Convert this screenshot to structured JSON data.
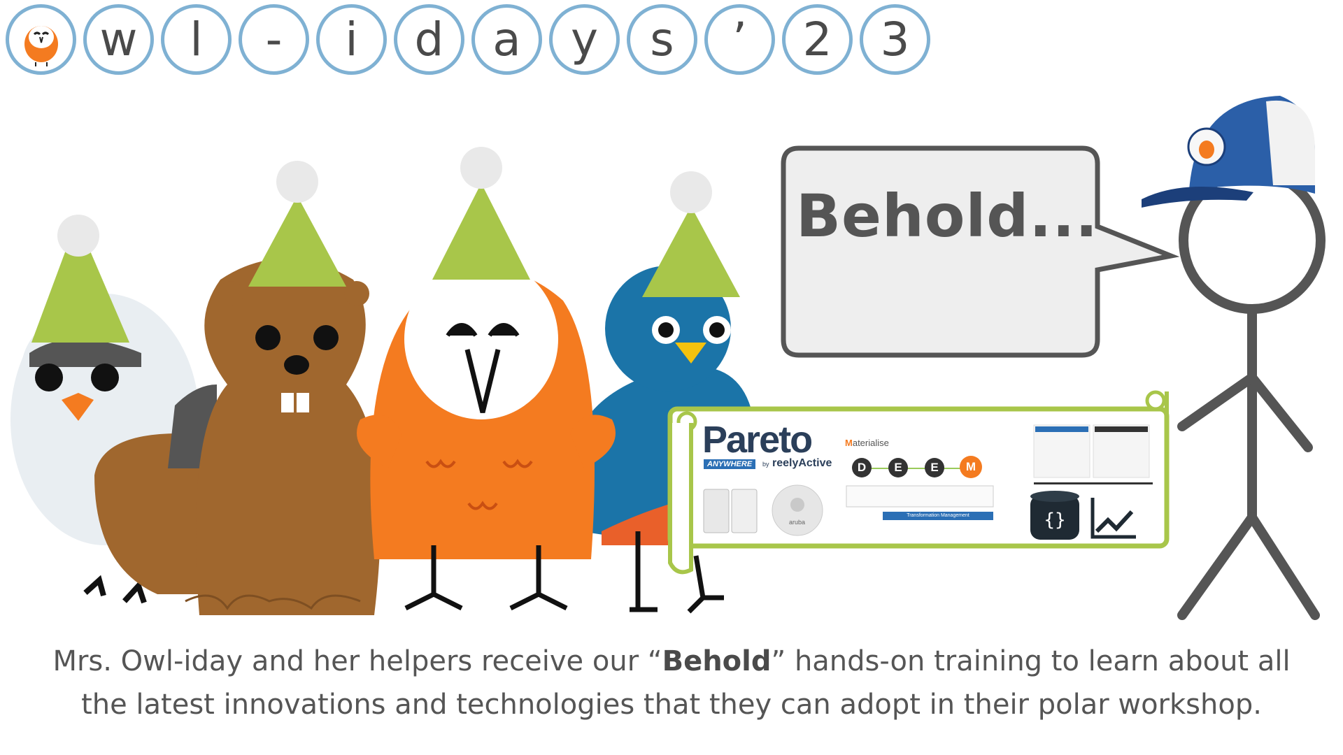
{
  "title": {
    "logo_icon": "owl-face-icon",
    "letters": [
      "w",
      "l",
      "-",
      "i",
      "d",
      "a",
      "y",
      "s",
      "’",
      "2",
      "3"
    ]
  },
  "speech_bubble": {
    "text": "Behold..."
  },
  "scroll": {
    "pareto_logo": "Pareto",
    "anywhere_badge": "ANYWHERE",
    "by_text": "by",
    "brand": "reelyActive",
    "materialise_first": "M",
    "materialise_rest": "aterialise",
    "steps": [
      "D",
      "E",
      "E",
      "M"
    ],
    "transformation_bar": "Transformation Management",
    "aruba_label": "aruba",
    "icons": [
      "database-icon",
      "line-chart-icon"
    ]
  },
  "caption": {
    "line1_before": "Mrs. Owl-iday and her helpers receive our “",
    "line1_bold": "Behold",
    "line1_after": "” hands-on training to learn about all",
    "line2": "the latest innovations and technologies that they can adopt in their polar workshop."
  },
  "colors": {
    "circle_border": "#7fb1d3",
    "hat_green": "#a8c64a",
    "owl_orange": "#f47b20",
    "beaver_brown": "#a0672e",
    "bird_blue": "#1b74a8",
    "cap_blue": "#2b5fa8",
    "scroll_border": "#a8c64a",
    "stick_gray": "#555555"
  }
}
